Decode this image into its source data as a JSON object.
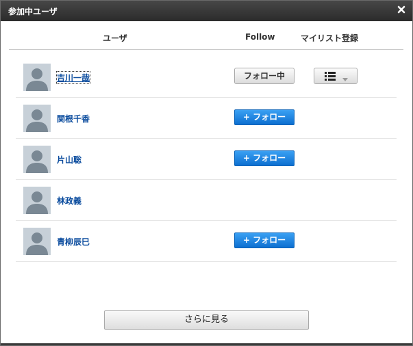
{
  "dialog": {
    "title": "参加中ユーザ",
    "close_icon": "close-icon"
  },
  "header": {
    "user": "ユーザ",
    "follow": "Follow",
    "mylist": "マイリスト登録"
  },
  "users": [
    {
      "name": "吉川一哉",
      "follow_label": "フォロー中",
      "mylist_icon": "list-menu-icon"
    },
    {
      "name": "関根千香",
      "follow_label": "+ フォロー"
    },
    {
      "name": "片山聡",
      "follow_label": "+ フォロー"
    },
    {
      "name": "林政義"
    },
    {
      "name": "青柳辰巳",
      "follow_label": "+ フォロー"
    }
  ],
  "footer": {
    "more_label": "さらに見る"
  },
  "colors": {
    "title_bg": "#333333",
    "link": "#0b4c9e",
    "follow_blue": "#1a7fe0"
  }
}
